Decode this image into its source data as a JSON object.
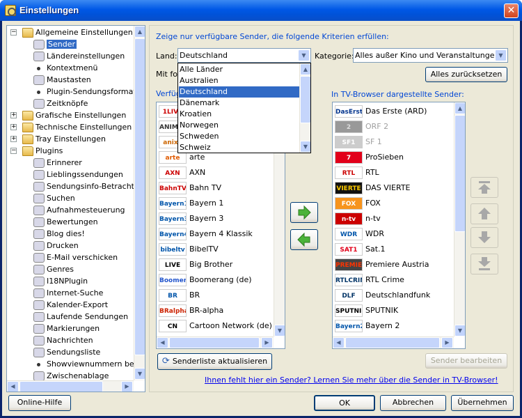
{
  "window": {
    "title": "Einstellungen",
    "close_label": "✕"
  },
  "tree": {
    "items": [
      {
        "label": "Allgemeine Einstellungen",
        "icon": "folder-icon",
        "exp": "−"
      },
      {
        "label": "Sender",
        "icon": "remote-icon",
        "selected": true
      },
      {
        "label": "Ländereinstellungen",
        "icon": "monitor-icon"
      },
      {
        "label": "Kontextmenü",
        "icon": "bullet-icon"
      },
      {
        "label": "Maustasten",
        "icon": "mouse-icon"
      },
      {
        "label": "Plugin-Sendungsformatierung",
        "icon": "bullet-icon"
      },
      {
        "label": "Zeitknöpfe",
        "icon": "clock-icon"
      },
      {
        "label": "Grafische Einstellungen",
        "icon": "folder-icon",
        "exp": "+"
      },
      {
        "label": "Technische Einstellungen",
        "icon": "folder-icon",
        "exp": "+"
      },
      {
        "label": "Tray Einstellungen",
        "icon": "folder-icon",
        "exp": "+"
      },
      {
        "label": "Plugins",
        "icon": "folder-icon",
        "exp": "−"
      },
      {
        "label": "Erinnerer",
        "icon": "reminder-icon"
      },
      {
        "label": "Lieblingssendungen",
        "icon": "heart-icon"
      },
      {
        "label": "Sendungsinfo-Betrachter",
        "icon": "info-viewer-icon"
      },
      {
        "label": "Suchen",
        "icon": "search-icon"
      },
      {
        "label": "Aufnahmesteuerung",
        "icon": "record-icon"
      },
      {
        "label": "Bewertungen",
        "icon": "rating-icon"
      },
      {
        "label": "Blog dies!",
        "icon": "blog-icon"
      },
      {
        "label": "Drucken",
        "icon": "print-icon"
      },
      {
        "label": "E-Mail verschicken",
        "icon": "mail-icon"
      },
      {
        "label": "Genres",
        "icon": "genres-icon"
      },
      {
        "label": "I18NPlugin",
        "icon": "i18n-icon"
      },
      {
        "label": "Internet-Suche",
        "icon": "web-search-icon"
      },
      {
        "label": "Kalender-Export",
        "icon": "calendar-icon"
      },
      {
        "label": "Laufende Sendungen",
        "icon": "running-shows-icon"
      },
      {
        "label": "Markierungen",
        "icon": "clip-icon"
      },
      {
        "label": "Nachrichten",
        "icon": "news-icon"
      },
      {
        "label": "Sendungsliste",
        "icon": "list-icon"
      },
      {
        "label": "Showviewnummern berechnen",
        "icon": "bullet-icon"
      },
      {
        "label": "Zwischenablage",
        "icon": "clipboard-icon"
      }
    ]
  },
  "filter": {
    "heading": "Zeige nur verfügbare Sender, die folgende Kriterien erfüllen:",
    "land_label": "Land:",
    "land_value": "Deutschland",
    "kategorie_label": "Kategorie:",
    "kategorie_value": "Alles außer Kino und Veranstaltungen",
    "mit_label": "Mit folg",
    "reset_button": "Alles zurücksetzen"
  },
  "dropdown": {
    "options": [
      "Alle Länder",
      "Australien",
      "Deutschland",
      "Dänemark",
      "Kroatien",
      "Norwegen",
      "Schweden",
      "Schweiz"
    ],
    "highlighted_index": 2
  },
  "available": {
    "heading": "Verfüg",
    "channels": [
      {
        "name": "",
        "logo": "1LIVE",
        "bg": "#ffffff",
        "fg": "#cc0000"
      },
      {
        "name": "",
        "logo": "ANIMAX",
        "bg": "#ffffff",
        "fg": "#333333"
      },
      {
        "name": "",
        "logo": "anixe",
        "bg": "#ffffff",
        "fg": "#cc6600"
      },
      {
        "name": "arte",
        "logo": "arte",
        "bg": "#ffffff",
        "fg": "#e05a00"
      },
      {
        "name": "AXN",
        "logo": "AXN",
        "bg": "#ffffff",
        "fg": "#cc0000"
      },
      {
        "name": "Bahn TV",
        "logo": "BahnTV",
        "bg": "#ffffff",
        "fg": "#cc0000"
      },
      {
        "name": "Bayern 1",
        "logo": "Bayern1",
        "bg": "#ffffff",
        "fg": "#0055aa"
      },
      {
        "name": "Bayern 3",
        "logo": "Bayern3",
        "bg": "#ffffff",
        "fg": "#0055aa"
      },
      {
        "name": "Bayern 4 Klassik",
        "logo": "Bayern4",
        "bg": "#ffffff",
        "fg": "#0055aa"
      },
      {
        "name": "BibelTV",
        "logo": "bibeltv",
        "bg": "#ffffff",
        "fg": "#0055aa"
      },
      {
        "name": "Big Brother",
        "logo": "LIVE",
        "bg": "#ffffff",
        "fg": "#000000"
      },
      {
        "name": "Boomerang (de)",
        "logo": "Boomerang",
        "bg": "#ffffff",
        "fg": "#2255cc"
      },
      {
        "name": "BR",
        "logo": "BR",
        "bg": "#ffffff",
        "fg": "#0055aa"
      },
      {
        "name": "BR-alpha",
        "logo": "BRalpha",
        "bg": "#ffffff",
        "fg": "#cc2200"
      },
      {
        "name": "Cartoon Network (de)",
        "logo": "CN",
        "bg": "#ffffff",
        "fg": "#000000"
      }
    ]
  },
  "displayed": {
    "heading": "In TV-Browser dargestellte Sender:",
    "channels": [
      {
        "name": "Das Erste (ARD)",
        "logo": "DasErste",
        "bg": "#ffffff",
        "fg": "#00338d",
        "grey": false
      },
      {
        "name": "ORF 2",
        "logo": "2",
        "bg": "#999999",
        "fg": "#dddddd",
        "grey": true
      },
      {
        "name": "SF 1",
        "logo": "SF1",
        "bg": "#cccccc",
        "fg": "#ffffff",
        "grey": true
      },
      {
        "name": "ProSieben",
        "logo": "7",
        "bg": "#e2001a",
        "fg": "#ffffff",
        "grey": false
      },
      {
        "name": "RTL",
        "logo": "RTL",
        "bg": "#ffffff",
        "fg": "#cc0000",
        "grey": false
      },
      {
        "name": "DAS VIERTE",
        "logo": "VIERTE",
        "bg": "#111111",
        "fg": "#ffcc00",
        "grey": false
      },
      {
        "name": "FOX",
        "logo": "FOX",
        "bg": "#f7941d",
        "fg": "#ffffff",
        "grey": false
      },
      {
        "name": "n-tv",
        "logo": "n-tv",
        "bg": "#cc0000",
        "fg": "#ffffff",
        "grey": false
      },
      {
        "name": "WDR",
        "logo": "WDR",
        "bg": "#ffffff",
        "fg": "#0055aa",
        "grey": false
      },
      {
        "name": "Sat.1",
        "logo": "SAT1",
        "bg": "#ffffff",
        "fg": "#e2001a",
        "grey": false
      },
      {
        "name": "Premiere Austria",
        "logo": "PREMIERE",
        "bg": "#444444",
        "fg": "#ff3300",
        "grey": false
      },
      {
        "name": "RTL Crime",
        "logo": "RTLCRIME",
        "bg": "#ffffff",
        "fg": "#003366",
        "grey": false
      },
      {
        "name": "Deutschlandfunk",
        "logo": "DLF",
        "bg": "#ffffff",
        "fg": "#003366",
        "grey": false
      },
      {
        "name": "SPUTNIK",
        "logo": "SPUTNIK",
        "bg": "#ffffff",
        "fg": "#000000",
        "grey": false
      },
      {
        "name": "Bayern 2",
        "logo": "Bayern2",
        "bg": "#ffffff",
        "fg": "#0055aa",
        "grey": false
      }
    ]
  },
  "buttons": {
    "refresh": "Senderliste aktualisieren",
    "edit": "Sender bearbeiten",
    "help": "Online-Hilfe",
    "ok": "OK",
    "cancel": "Abbrechen",
    "apply": "Übernehmen"
  },
  "link": "Ihnen fehlt hier ein Sender? Lernen Sie mehr über die Sender in TV-Browser!"
}
